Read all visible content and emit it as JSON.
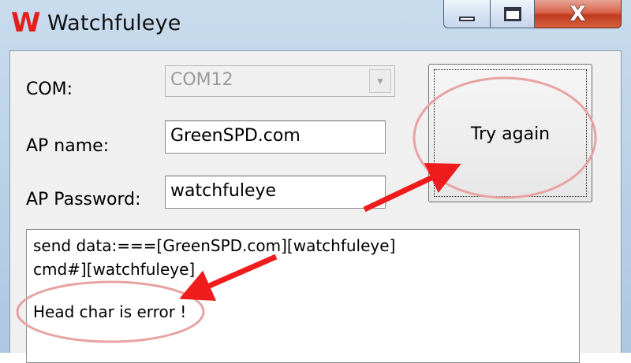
{
  "window": {
    "icon_glyph": "W",
    "title": "Watchfuleye",
    "controls": {
      "minimize": "minimize-icon",
      "maximize": "maximize-icon",
      "close_glyph": "X"
    }
  },
  "form": {
    "com_label": "COM:",
    "com_value": "COM12",
    "ap_name_label": "AP name:",
    "ap_name_value": "GreenSPD.com",
    "ap_password_label": "AP Password:",
    "ap_password_value": "watchfuleye"
  },
  "try_again_label": "Try again",
  "log": {
    "lines": [
      "send data:===[GreenSPD.com][watchfuleye]",
      "cmd#][watchfuleye]",
      "Head char is error !"
    ]
  },
  "annotations": {
    "ellipse_color": "#e8a2a2",
    "arrow_color": "#ee1c1c"
  }
}
